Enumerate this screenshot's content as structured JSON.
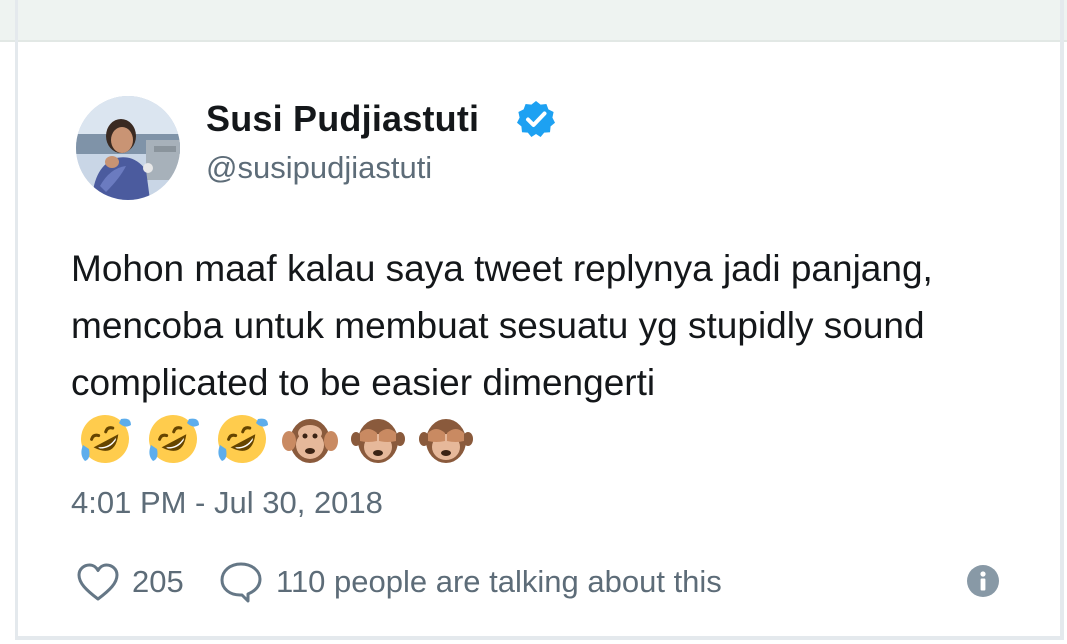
{
  "user": {
    "display_name": "Susi Pudjiastuti",
    "handle": "@susipudjiastuti",
    "verified": true
  },
  "tweet": {
    "text": "Mohon maaf kalau saya tweet replynya jadi panjang, mencoba untuk membuat sesuatu yg stupidly sound complicated to be easier dimengerti",
    "emojis": [
      "rolling-on-floor-laughing",
      "rolling-on-floor-laughing",
      "rolling-on-floor-laughing",
      "hear-no-evil-monkey",
      "see-no-evil-monkey",
      "see-no-evil-monkey"
    ],
    "timestamp": "4:01 PM - Jul 30, 2018"
  },
  "actions": {
    "likes": "205",
    "talking": "110 people are talking about this"
  },
  "icons": {
    "verified": "verified-badge-icon",
    "like": "heart-icon",
    "talk": "speech-bubble-icon",
    "info": "info-icon"
  },
  "colors": {
    "verified_blue": "#1da1f2",
    "text_primary": "#14171a",
    "text_secondary": "#5d6c78",
    "icon_gray": "#657786"
  }
}
